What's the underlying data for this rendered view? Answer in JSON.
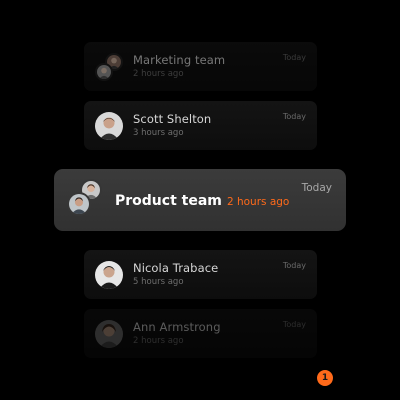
{
  "notifications": [
    {
      "name": "Marketing team",
      "time": "2 hours ago",
      "date": "Today"
    },
    {
      "name": "Scott Shelton",
      "time": "3 hours ago",
      "date": "Today"
    },
    {
      "name": "Product team",
      "time": "2 hours ago",
      "date": "Today",
      "unread": "1"
    },
    {
      "name": "Nicola Trabace",
      "time": "5 hours ago",
      "date": "Today"
    },
    {
      "name": "Ann Armstrong",
      "time": "2 hours ago",
      "date": "Today"
    }
  ],
  "colors": {
    "background": "#000000",
    "accent": "#ff6a1a",
    "active_card": "#363636",
    "card": "#111111"
  },
  "icons": {
    "avatar": "person-avatar-icon",
    "group_avatar": "group-avatar-icon"
  }
}
